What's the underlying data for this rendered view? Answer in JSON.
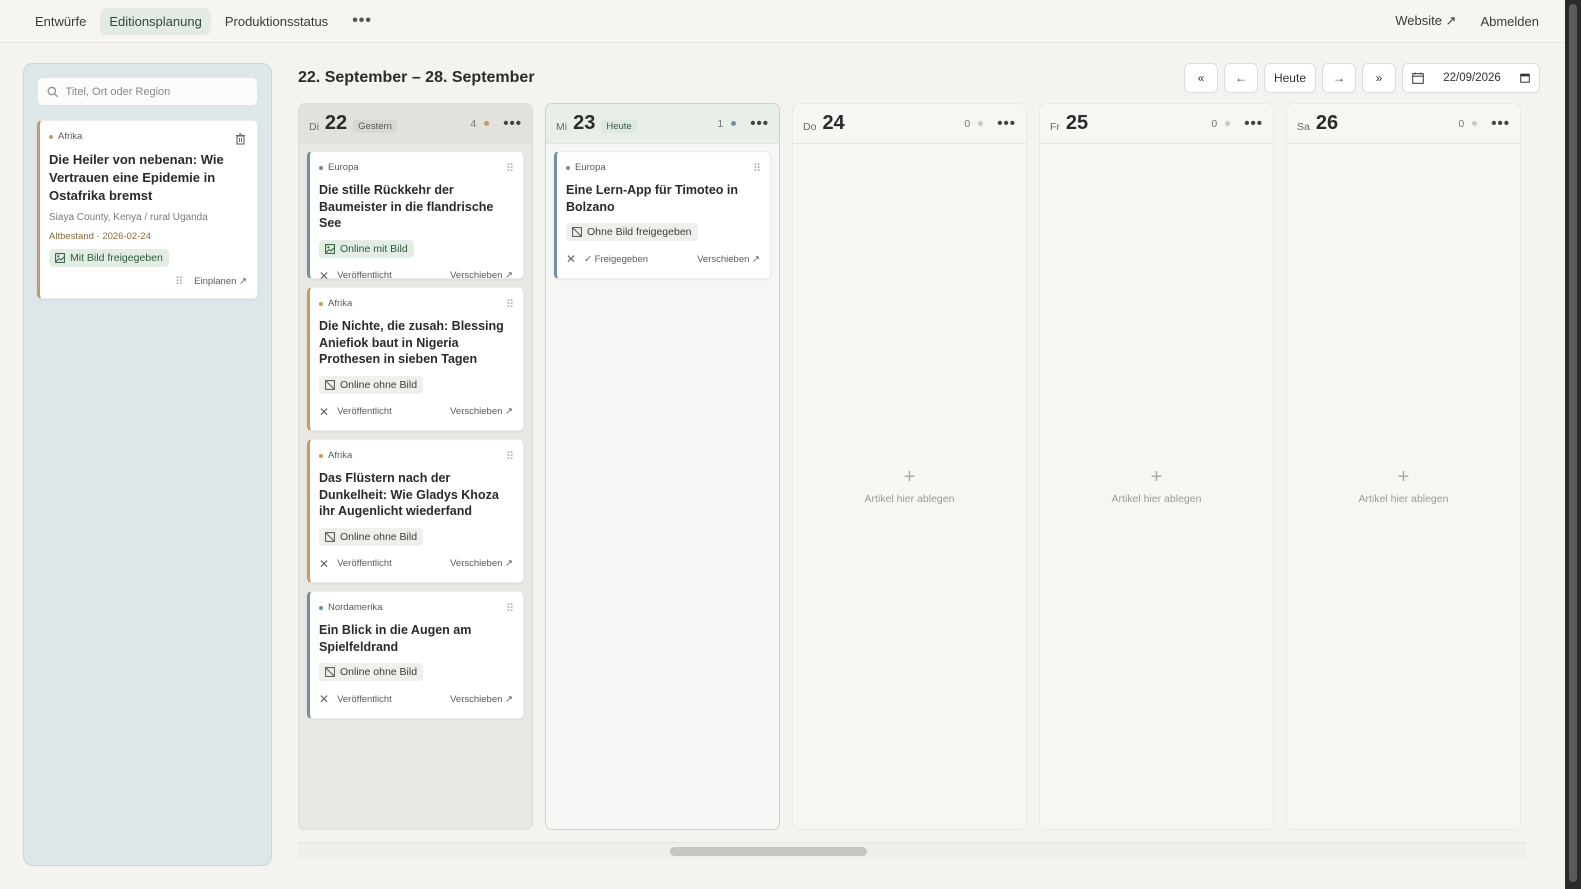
{
  "nav": {
    "tabs": [
      {
        "label": "Entwürfe",
        "active": false
      },
      {
        "label": "Editionsplanung",
        "active": true
      },
      {
        "label": "Produktionsstatus",
        "active": false
      }
    ],
    "more": "•••",
    "website": "Website ↗",
    "logout": "Abmelden"
  },
  "drafts": {
    "search_placeholder": "Titel, Ort oder Region",
    "cards": [
      {
        "region": "Afrika",
        "title": "Die Heiler von nebenan: Wie Vertrauen eine Epidemie in Ostafrika bremst",
        "place": "Siaya County, Kenya / rural Uganda",
        "meta": "Altbestand · 2026-02-24",
        "badge": "Mit Bild freigegeben",
        "action": "Einplanen ↗"
      }
    ]
  },
  "header": {
    "week_title": "22. September – 28. September",
    "today_btn": "Heute",
    "date_value": "22/09/2026"
  },
  "days": [
    {
      "name": "Di",
      "num": "22",
      "tag": "Gestern",
      "count": "4",
      "dot_color": "#c59a66",
      "cards": [
        {
          "region": "Europa",
          "title": "Die stille Rückkehr der Baumeister in die flandrische See",
          "badge": "Online mit Bild",
          "status": "Veröffentlicht",
          "move": "Verschieben ↗"
        },
        {
          "region": "Afrika",
          "title": "Die Nichte, die zusah: Blessing Aniefiok baut in Nigeria Prothesen in sieben Tagen",
          "badge": "Online ohne Bild",
          "status": "Veröffentlicht",
          "move": "Verschieben ↗"
        },
        {
          "region": "Afrika",
          "title": "Das Flüstern nach der Dunkelheit: Wie Gladys Khoza ihr Augenlicht wiederfand",
          "badge": "Online ohne Bild",
          "status": "Veröffentlicht",
          "move": "Verschieben ↗"
        },
        {
          "region": "Nordamerika",
          "title": "Ein Blick in die Augen am Spielfeldrand",
          "badge": "Online ohne Bild",
          "status": "Veröffentlicht",
          "move": "Verschieben ↗"
        }
      ]
    },
    {
      "name": "Mi",
      "num": "23",
      "tag": "Heute",
      "count": "1",
      "dot_color": "#6f8fa4",
      "cards": [
        {
          "region": "Europa",
          "title": "Eine Lern-App für Timoteo in Bolzano",
          "badge": "Ohne Bild freigegeben",
          "status": "✓ Freigegeben",
          "move": "Verschieben ↗"
        }
      ]
    },
    {
      "name": "Do",
      "num": "24",
      "tag": "",
      "count": "0",
      "dot_color": "#c8c8c4",
      "cards": [],
      "empty": "Artikel hier ablegen"
    },
    {
      "name": "Fr",
      "num": "25",
      "tag": "",
      "count": "0",
      "dot_color": "#c8c8c4",
      "cards": [],
      "empty": "Artikel hier ablegen"
    },
    {
      "name": "Sa",
      "num": "26",
      "tag": "",
      "count": "0",
      "dot_color": "#c8c8c4",
      "cards": [],
      "empty": "Artikel hier ablegen"
    }
  ],
  "colors": {
    "africa": "#c59a66",
    "europe": "#6f8fa4",
    "accent": "#2f4a3c"
  }
}
